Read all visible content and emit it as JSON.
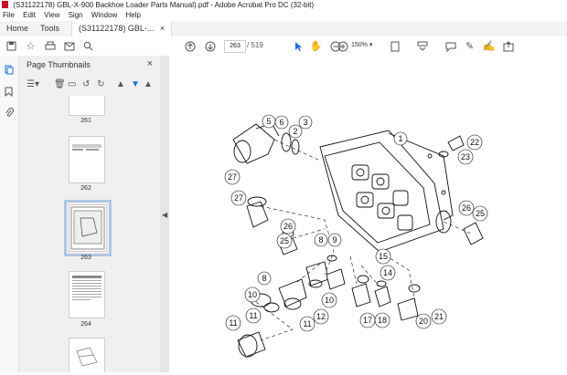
{
  "window": {
    "title": "(S31122178) GBL-X-900 Backhoe Loader Parts Manual).pdf - Adobe Acrobat Pro DC (32-bit)"
  },
  "menu": [
    "File",
    "Edit",
    "View",
    "Sign",
    "Window",
    "Help"
  ],
  "tabs": {
    "home": "Home",
    "tools": "Tools",
    "document": "(S31122178) GBL-..."
  },
  "toolbar": {
    "current_page": "263",
    "page_count": "/ 519",
    "zoom": "150%"
  },
  "panel": {
    "title": "Page Thumbnails"
  },
  "thumbnails": [
    {
      "label": "261"
    },
    {
      "label": "262"
    },
    {
      "label": "263"
    },
    {
      "label": "264"
    }
  ],
  "callouts": [
    "1",
    "2",
    "3",
    "5",
    "6",
    "8",
    "8",
    "9",
    "10",
    "10",
    "11",
    "11",
    "11",
    "12",
    "14",
    "15",
    "17",
    "18",
    "20",
    "21",
    "22",
    "23",
    "25",
    "25",
    "26",
    "26",
    "27",
    "27"
  ]
}
